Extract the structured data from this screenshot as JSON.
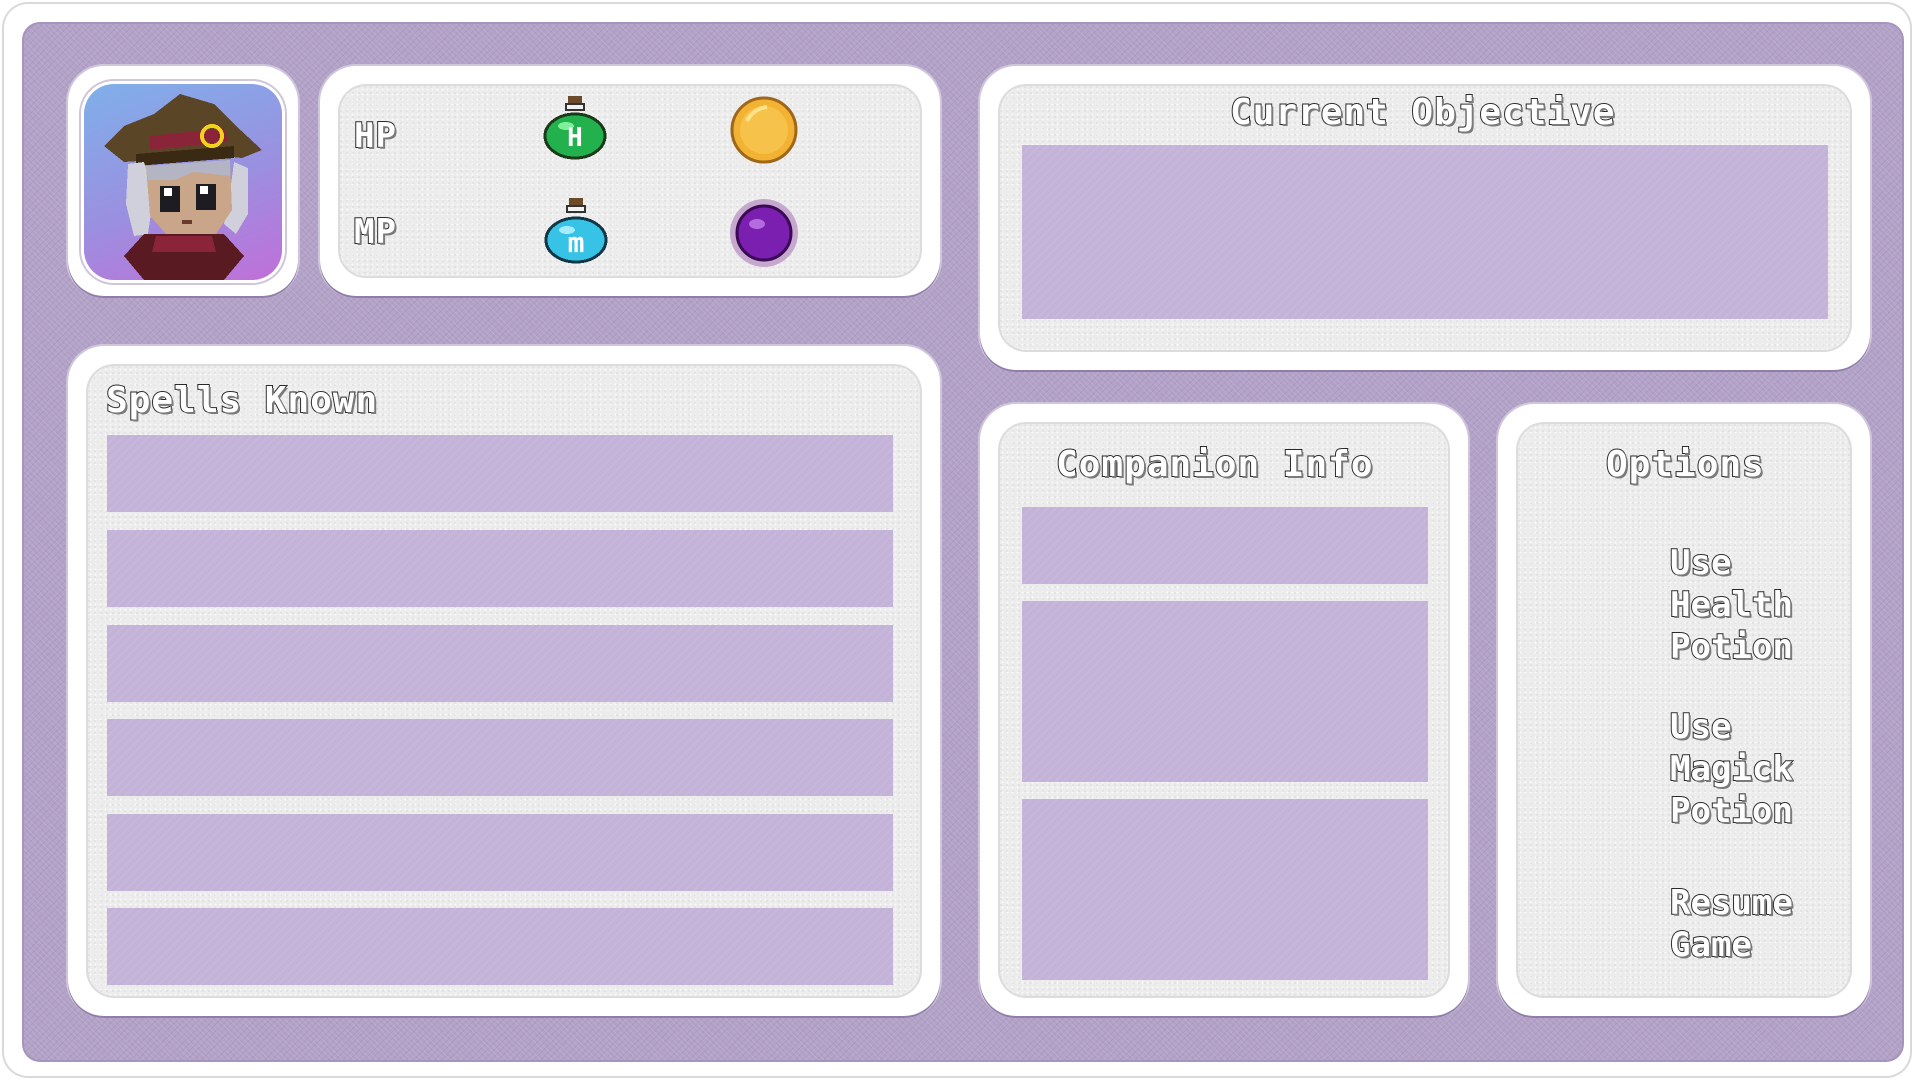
{
  "stats": {
    "hp_label": "HP",
    "mp_label": "MP",
    "hp_potion_letter": "H",
    "mp_potion_letter": "m"
  },
  "objective": {
    "title": "Current Objective"
  },
  "spells": {
    "title": "Spells Known",
    "slot_count": 6
  },
  "companion": {
    "title": "Companion Info"
  },
  "options": {
    "title": "Options",
    "items": [
      {
        "lines": [
          "Use",
          "Health",
          "Potion"
        ]
      },
      {
        "lines": [
          "Use",
          "Magick",
          "Potion"
        ]
      },
      {
        "lines": [
          "Resume",
          "Game"
        ]
      }
    ]
  },
  "colors": {
    "background": "#b3a2c7",
    "slot": "#c4b3d9",
    "panel": "#ececec",
    "hp_potion": "#22b14c",
    "mp_potion": "#36c3e6",
    "coin": "#f2b233",
    "orb": "#7a1fb0"
  },
  "icons": [
    "character-portrait",
    "health-potion-icon",
    "gold-coin-icon",
    "magick-potion-icon",
    "magic-orb-icon"
  ]
}
